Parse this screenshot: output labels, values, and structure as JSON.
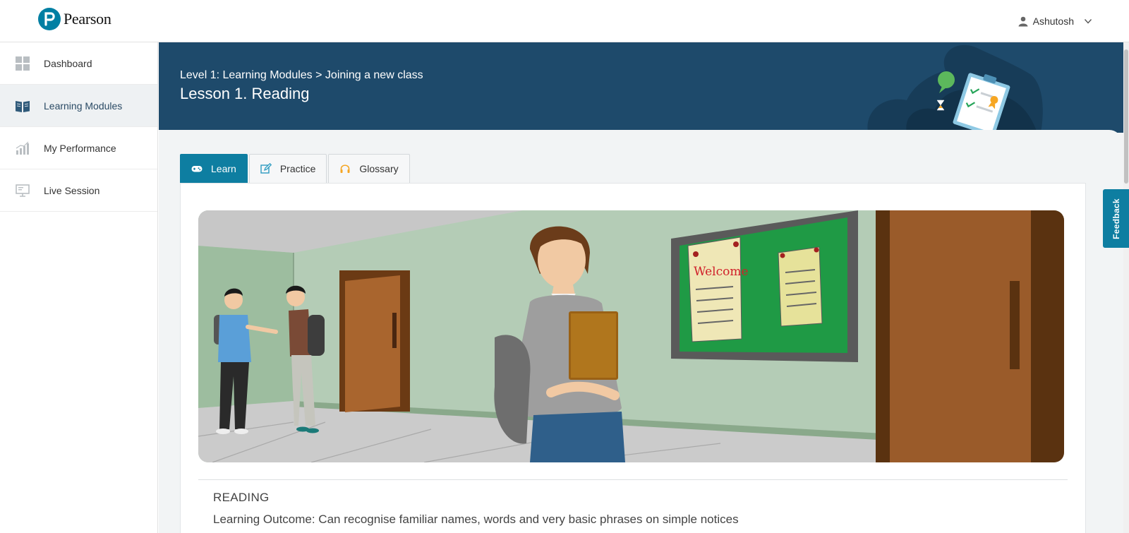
{
  "brand": {
    "name": "Pearson",
    "color": "#007fa3"
  },
  "user": {
    "name": "Ashutosh",
    "icon": "user-icon",
    "menu_icon": "chevron-down-icon"
  },
  "sidebar": {
    "items": [
      {
        "label": "Dashboard",
        "icon": "dashboard-grid-icon",
        "active": false
      },
      {
        "label": "Learning Modules",
        "icon": "book-icon",
        "active": true
      },
      {
        "label": "My Performance",
        "icon": "bar-chart-icon",
        "active": false
      },
      {
        "label": "Live Session",
        "icon": "presentation-screen-icon",
        "active": false
      }
    ]
  },
  "banner": {
    "breadcrumb": "Level 1: Learning Modules > Joining a new class",
    "title": "Lesson 1. Reading",
    "background": "#1e4a6b"
  },
  "tabs": [
    {
      "label": "Learn",
      "icon": "gamepad-icon",
      "active": true
    },
    {
      "label": "Practice",
      "icon": "edit-icon",
      "active": false
    },
    {
      "label": "Glossary",
      "icon": "headphones-icon",
      "active": false
    }
  ],
  "scene": {
    "sign_text": "Welcome"
  },
  "reading": {
    "heading": "READING",
    "outcome": "Learning Outcome: Can recognise familiar names, words and very basic phrases on simple notices"
  },
  "feedback": {
    "label": "Feedback"
  },
  "colors": {
    "accent": "#0e7ea1",
    "banner": "#1e4a6b",
    "board": "#1f9a45",
    "door": "#9a5b2a"
  }
}
